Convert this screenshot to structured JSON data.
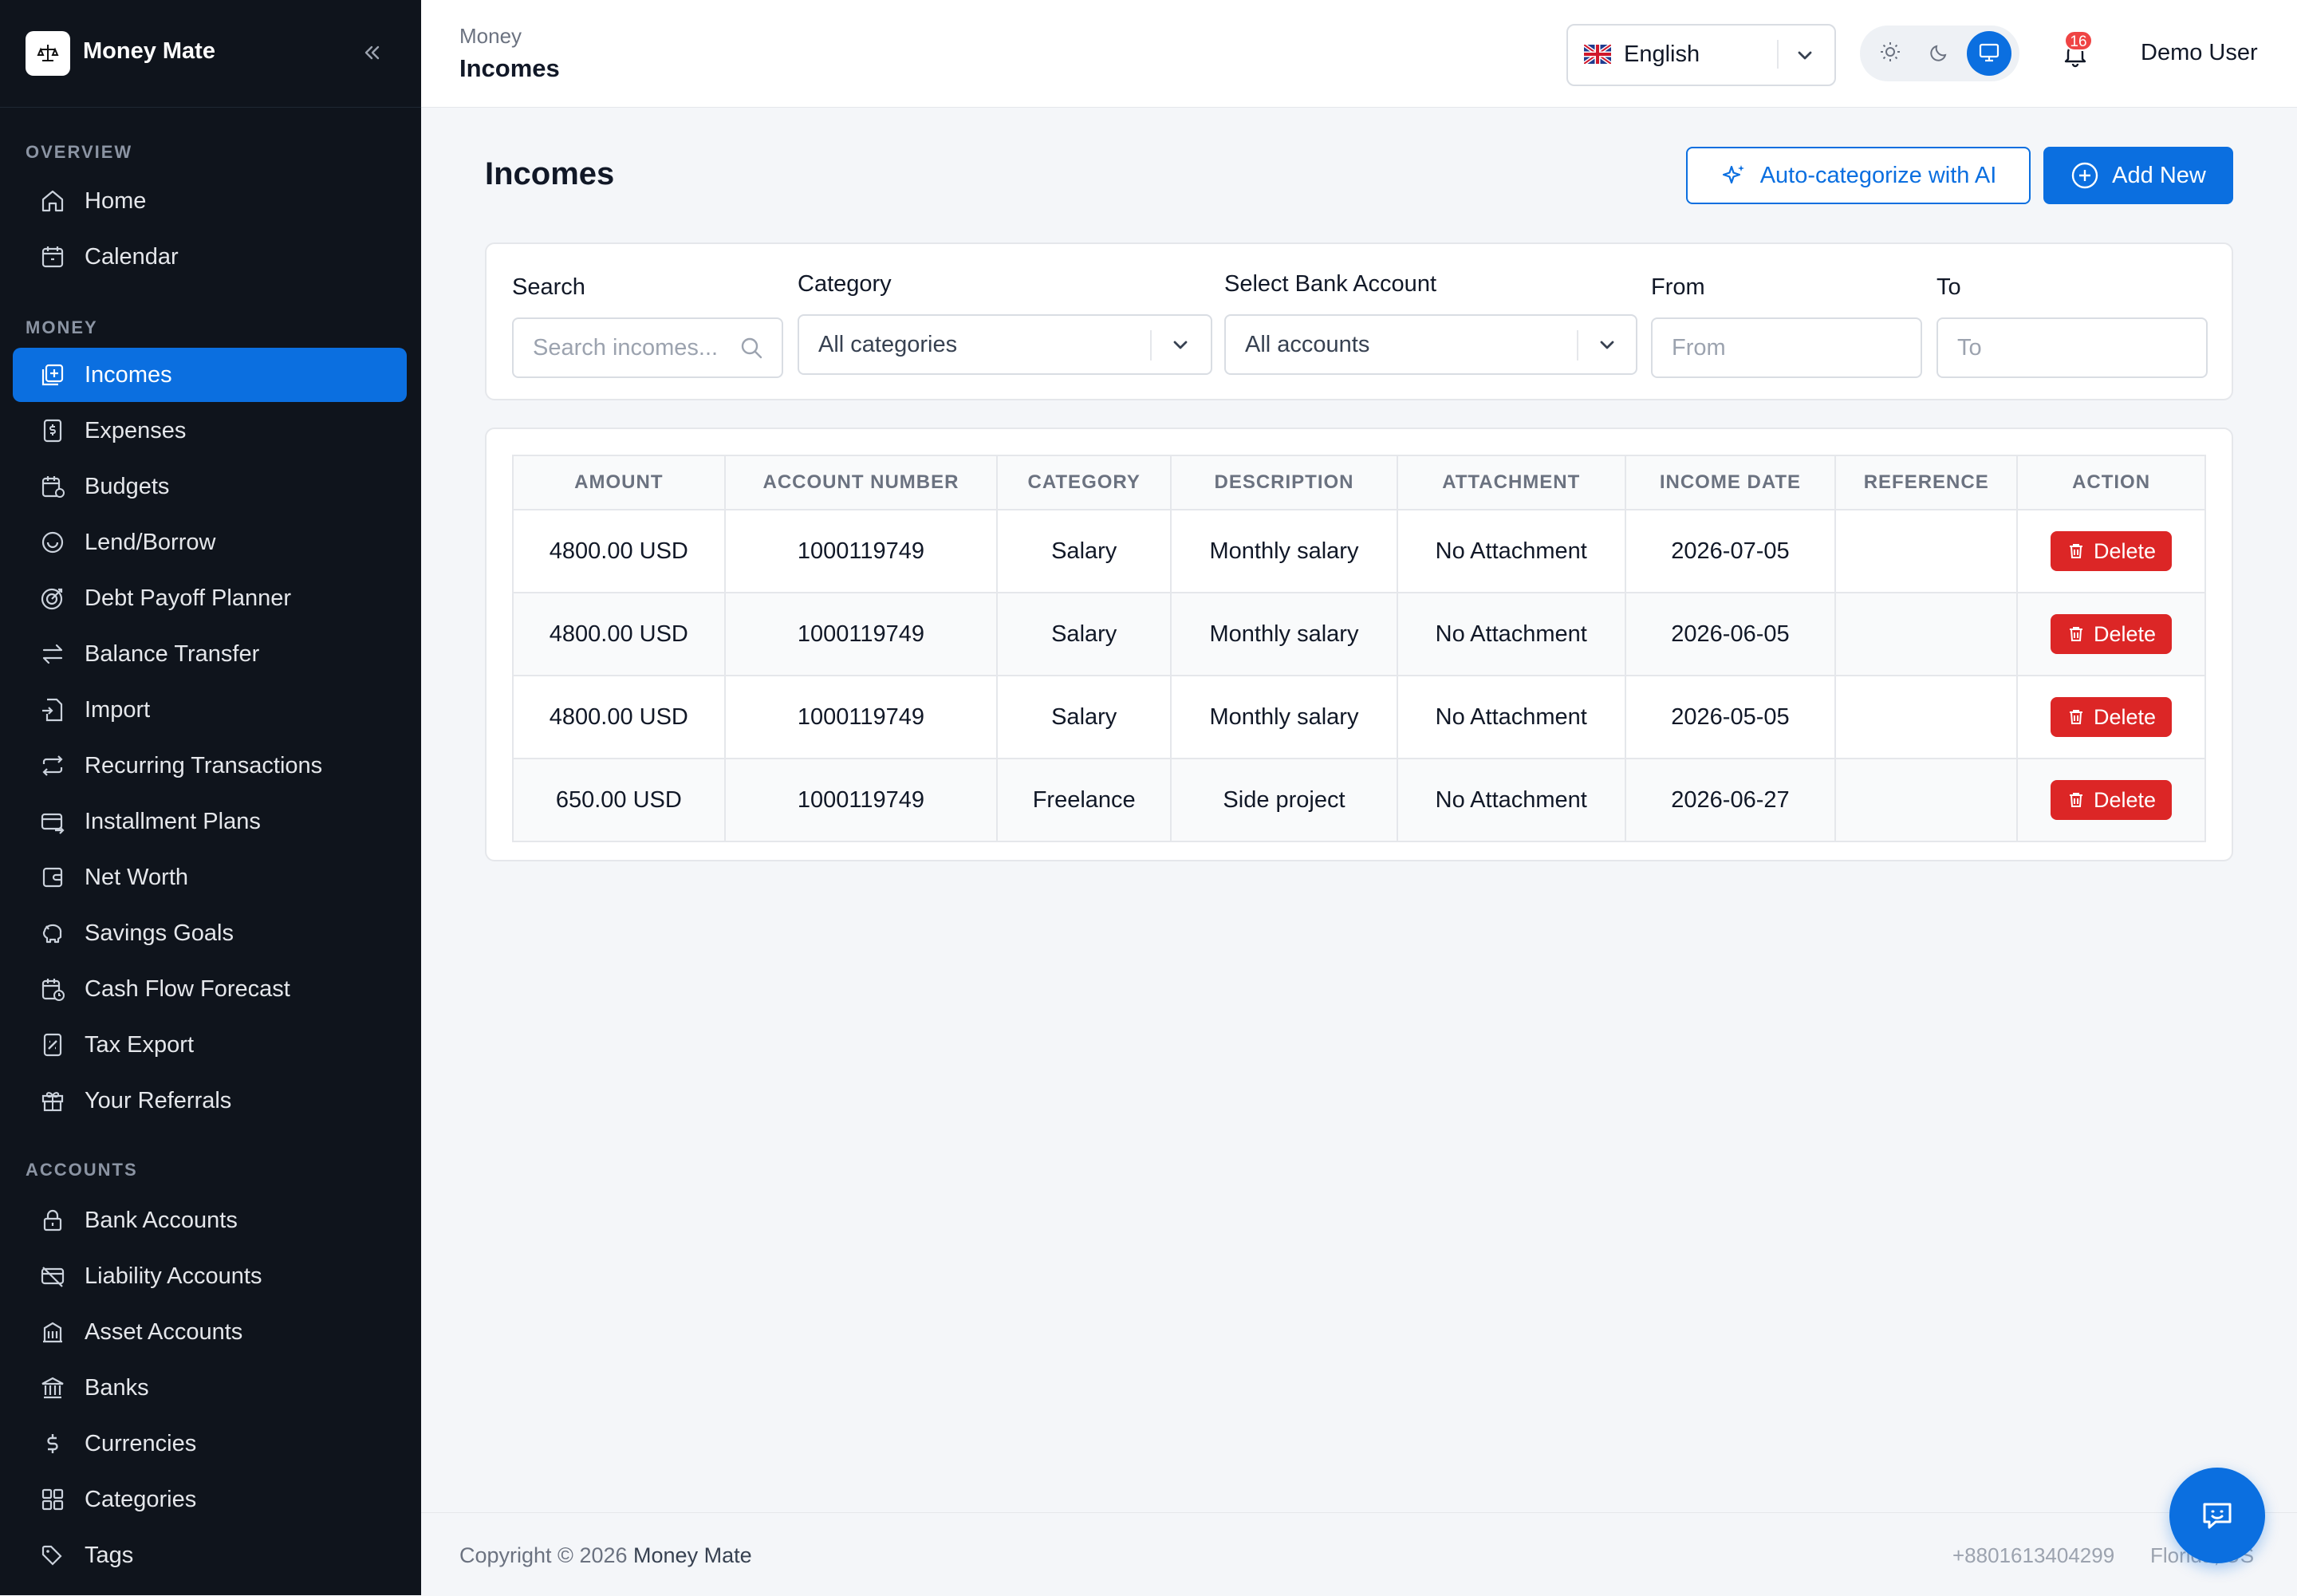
{
  "brand": {
    "name": "Money Mate",
    "logo_icon": "scales-logo-icon"
  },
  "sidebar": {
    "sections": [
      {
        "label": "OVERVIEW",
        "items": [
          {
            "label": "Home",
            "icon": "home-icon"
          },
          {
            "label": "Calendar",
            "icon": "calendar-icon"
          }
        ]
      },
      {
        "label": "MONEY",
        "items": [
          {
            "label": "Incomes",
            "icon": "incomes-icon",
            "active": true
          },
          {
            "label": "Expenses",
            "icon": "expenses-icon"
          },
          {
            "label": "Budgets",
            "icon": "budgets-icon"
          },
          {
            "label": "Lend/Borrow",
            "icon": "lend-borrow-icon"
          },
          {
            "label": "Debt Payoff Planner",
            "icon": "target-icon"
          },
          {
            "label": "Balance Transfer",
            "icon": "transfer-icon"
          },
          {
            "label": "Import",
            "icon": "import-icon"
          },
          {
            "label": "Recurring Transactions",
            "icon": "recurring-icon"
          },
          {
            "label": "Installment Plans",
            "icon": "installment-icon"
          },
          {
            "label": "Net Worth",
            "icon": "wallet-icon"
          },
          {
            "label": "Savings Goals",
            "icon": "piggy-bank-icon"
          },
          {
            "label": "Cash Flow Forecast",
            "icon": "forecast-icon"
          },
          {
            "label": "Tax Export",
            "icon": "tax-icon"
          },
          {
            "label": "Your Referrals",
            "icon": "gift-icon"
          }
        ]
      },
      {
        "label": "ACCOUNTS",
        "items": [
          {
            "label": "Bank Accounts",
            "icon": "bank-lock-icon"
          },
          {
            "label": "Liability Accounts",
            "icon": "liability-icon"
          },
          {
            "label": "Asset Accounts",
            "icon": "asset-icon"
          },
          {
            "label": "Banks",
            "icon": "bank-icon"
          },
          {
            "label": "Currencies",
            "icon": "dollar-icon"
          },
          {
            "label": "Categories",
            "icon": "grid-icon"
          },
          {
            "label": "Tags",
            "icon": "tags-icon"
          }
        ]
      }
    ]
  },
  "header": {
    "breadcrumb_parent": "Money",
    "breadcrumb_current": "Incomes",
    "language": "English",
    "notifications_count": "16",
    "user_name": "Demo User"
  },
  "main": {
    "title": "Incomes",
    "ai_button": "Auto-categorize with AI",
    "add_button": "Add New",
    "filters": {
      "search_label": "Search",
      "search_placeholder": "Search incomes...",
      "category_label": "Category",
      "category_value": "All categories",
      "bank_label": "Select Bank Account",
      "bank_value": "All accounts",
      "from_label": "From",
      "from_placeholder": "From",
      "to_label": "To",
      "to_placeholder": "To"
    },
    "table": {
      "columns": [
        "AMOUNT",
        "ACCOUNT NUMBER",
        "CATEGORY",
        "DESCRIPTION",
        "ATTACHMENT",
        "INCOME DATE",
        "REFERENCE",
        "ACTION"
      ],
      "delete_label": "Delete",
      "rows": [
        {
          "amount": "4800.00 USD",
          "account": "1000119749",
          "category": "Salary",
          "description": "Monthly salary",
          "attachment": "No Attachment",
          "date": "2026-07-05",
          "reference": ""
        },
        {
          "amount": "4800.00 USD",
          "account": "1000119749",
          "category": "Salary",
          "description": "Monthly salary",
          "attachment": "No Attachment",
          "date": "2026-06-05",
          "reference": ""
        },
        {
          "amount": "4800.00 USD",
          "account": "1000119749",
          "category": "Salary",
          "description": "Monthly salary",
          "attachment": "No Attachment",
          "date": "2026-05-05",
          "reference": ""
        },
        {
          "amount": "650.00 USD",
          "account": "1000119749",
          "category": "Freelance",
          "description": "Side project",
          "attachment": "No Attachment",
          "date": "2026-06-27",
          "reference": ""
        }
      ]
    }
  },
  "footer": {
    "copyright_prefix": "Copyright © 2026",
    "copyright_brand": "Money Mate",
    "phone": "+8801613404299",
    "address": "Florida, US"
  },
  "colors": {
    "accent": "#0b6fe0",
    "sidebar_bg": "#0f141c",
    "danger": "#dc2626"
  }
}
